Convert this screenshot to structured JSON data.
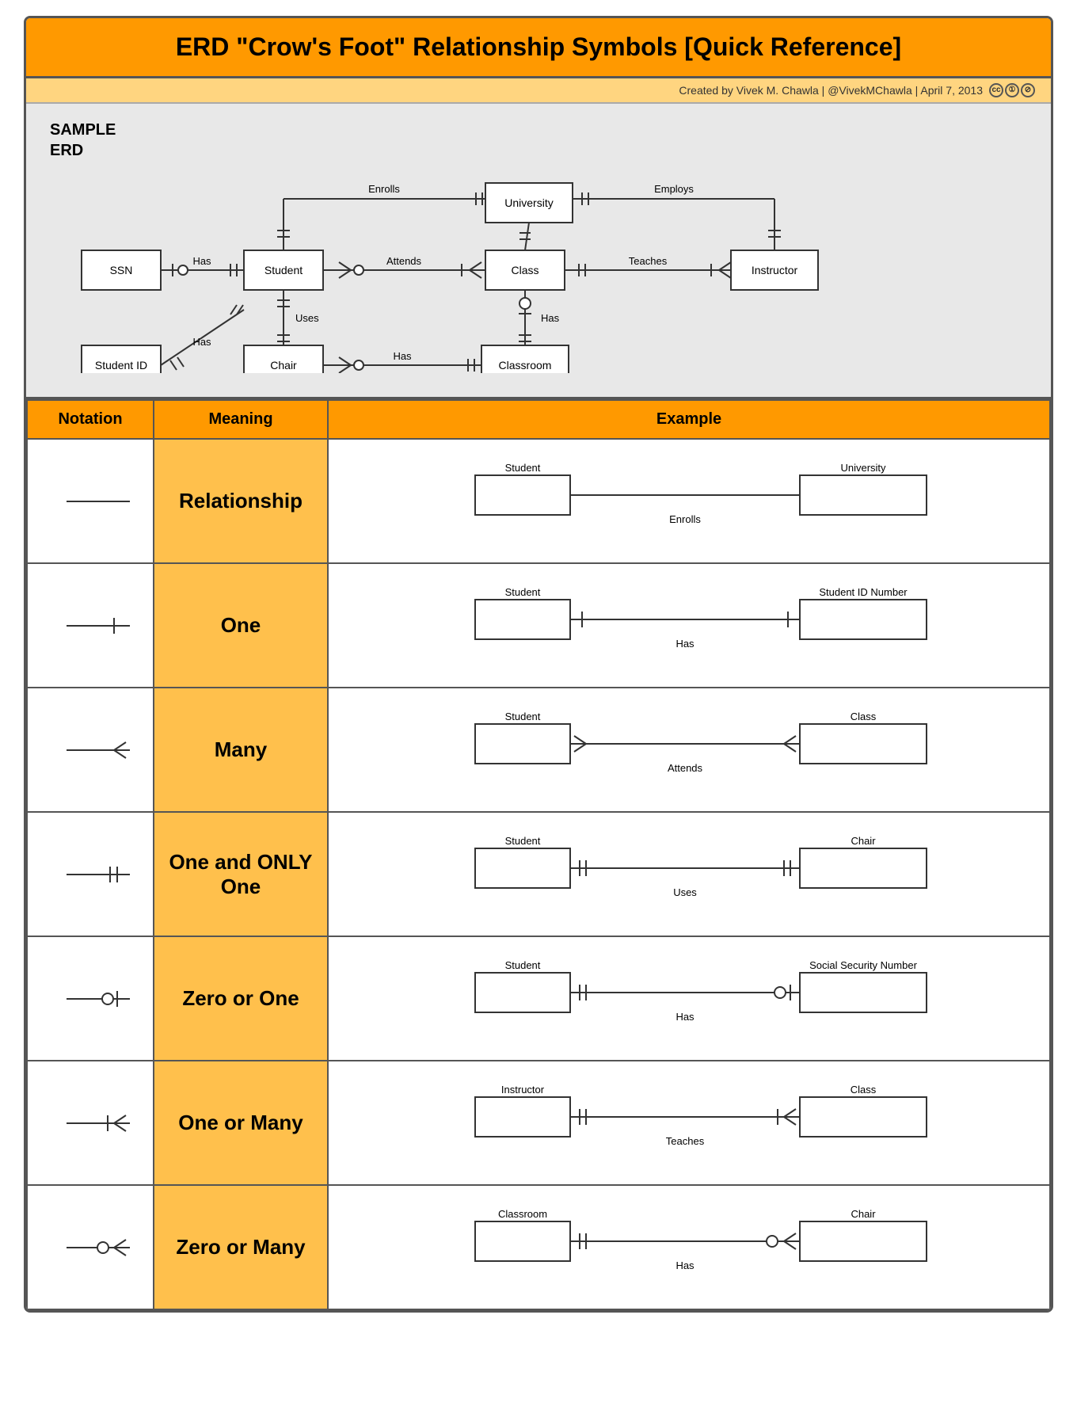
{
  "title": "ERD \"Crow's Foot\" Relationship Symbols [Quick Reference]",
  "subtitle": "Created by Vivek M. Chawla | @VivekMChawla | April 7, 2013",
  "cc": [
    "cc",
    "by",
    "nc"
  ],
  "erd_label": "SAMPLE\nERD",
  "table": {
    "headers": [
      "Notation",
      "Meaning",
      "Example"
    ],
    "rows": [
      {
        "meaning": "Relationship",
        "entity1": "Student",
        "entity2": "University",
        "rel_label": "Enrolls",
        "notation_type": "plain"
      },
      {
        "meaning": "One",
        "entity1": "Student",
        "entity2": "Student ID Number",
        "rel_label": "Has",
        "notation_type": "one"
      },
      {
        "meaning": "Many",
        "entity1": "Student",
        "entity2": "Class",
        "rel_label": "Attends",
        "notation_type": "many"
      },
      {
        "meaning": "One and ONLY One",
        "entity1": "Student",
        "entity2": "Chair",
        "rel_label": "Uses",
        "notation_type": "one_only"
      },
      {
        "meaning": "Zero or One",
        "entity1": "Student",
        "entity2": "Social Security Number",
        "rel_label": "Has",
        "notation_type": "zero_or_one"
      },
      {
        "meaning": "One or Many",
        "entity1": "Instructor",
        "entity2": "Class",
        "rel_label": "Teaches",
        "notation_type": "one_or_many"
      },
      {
        "meaning": "Zero or Many",
        "entity1": "Classroom",
        "entity2": "Chair",
        "rel_label": "Has",
        "notation_type": "zero_or_many"
      }
    ]
  }
}
